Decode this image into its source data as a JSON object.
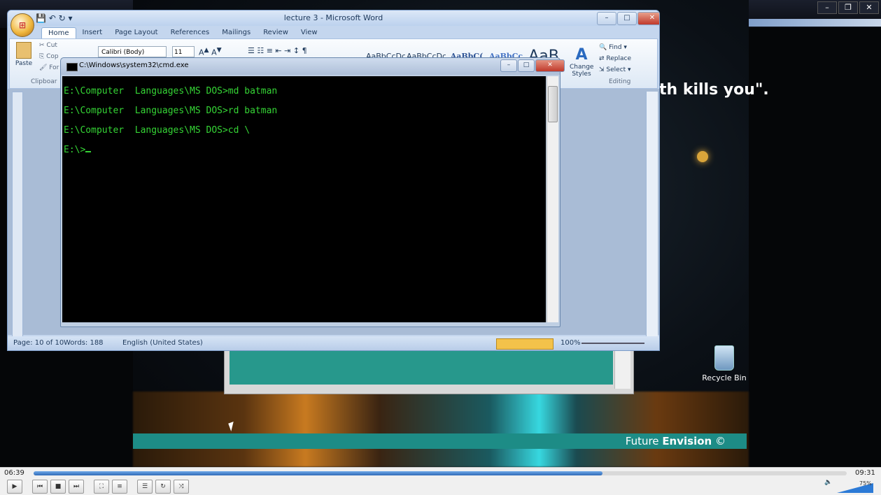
{
  "video": {
    "quote": "th kills you\".",
    "banner_text_plain": "Future ",
    "banner_text_bold": "Envision",
    "banner_mark": " ©",
    "desktop_icon_label": "Recycle Bin"
  },
  "word": {
    "title": "lecture 3 - Microsoft Word",
    "tabs": [
      "Home",
      "Insert",
      "Page Layout",
      "References",
      "Mailings",
      "Review",
      "View"
    ],
    "font_name": "Calibri (Body)",
    "font_size": "11",
    "paste_label": "Paste",
    "cut_label": "Cut",
    "copy_label": "Cop",
    "format_label": "For",
    "clipboard_group": "Clipboar",
    "styles": [
      "AaBbCcDc",
      "AaBbCcDc",
      "AaBbC(",
      "AaBbCc",
      "AaB"
    ],
    "change_styles": "Change Styles",
    "find_label": "Find",
    "replace_label": "Replace",
    "select_label": "Select",
    "editing_group": "Editing",
    "status_page": "Page: 10 of 10",
    "status_words": "Words: 188",
    "status_language": "English (United States)",
    "status_zoom": "100%"
  },
  "cmd": {
    "title": "C:\\Windows\\system32\\cmd.exe",
    "lines": [
      "E:\\Computer  Languages\\MS DOS>md batman",
      "E:\\Computer  Languages\\MS DOS>rd batman",
      "E:\\Computer  Languages\\MS DOS>cd \\",
      "E:\\>"
    ]
  },
  "player": {
    "elapsed": "06:39",
    "total": "09:31",
    "progress_fraction": 0.7,
    "volume": "75%"
  },
  "colors": {
    "console_text": "#35d435",
    "banner": "#1d8c86",
    "seek_fill": "#2f6bb8"
  }
}
